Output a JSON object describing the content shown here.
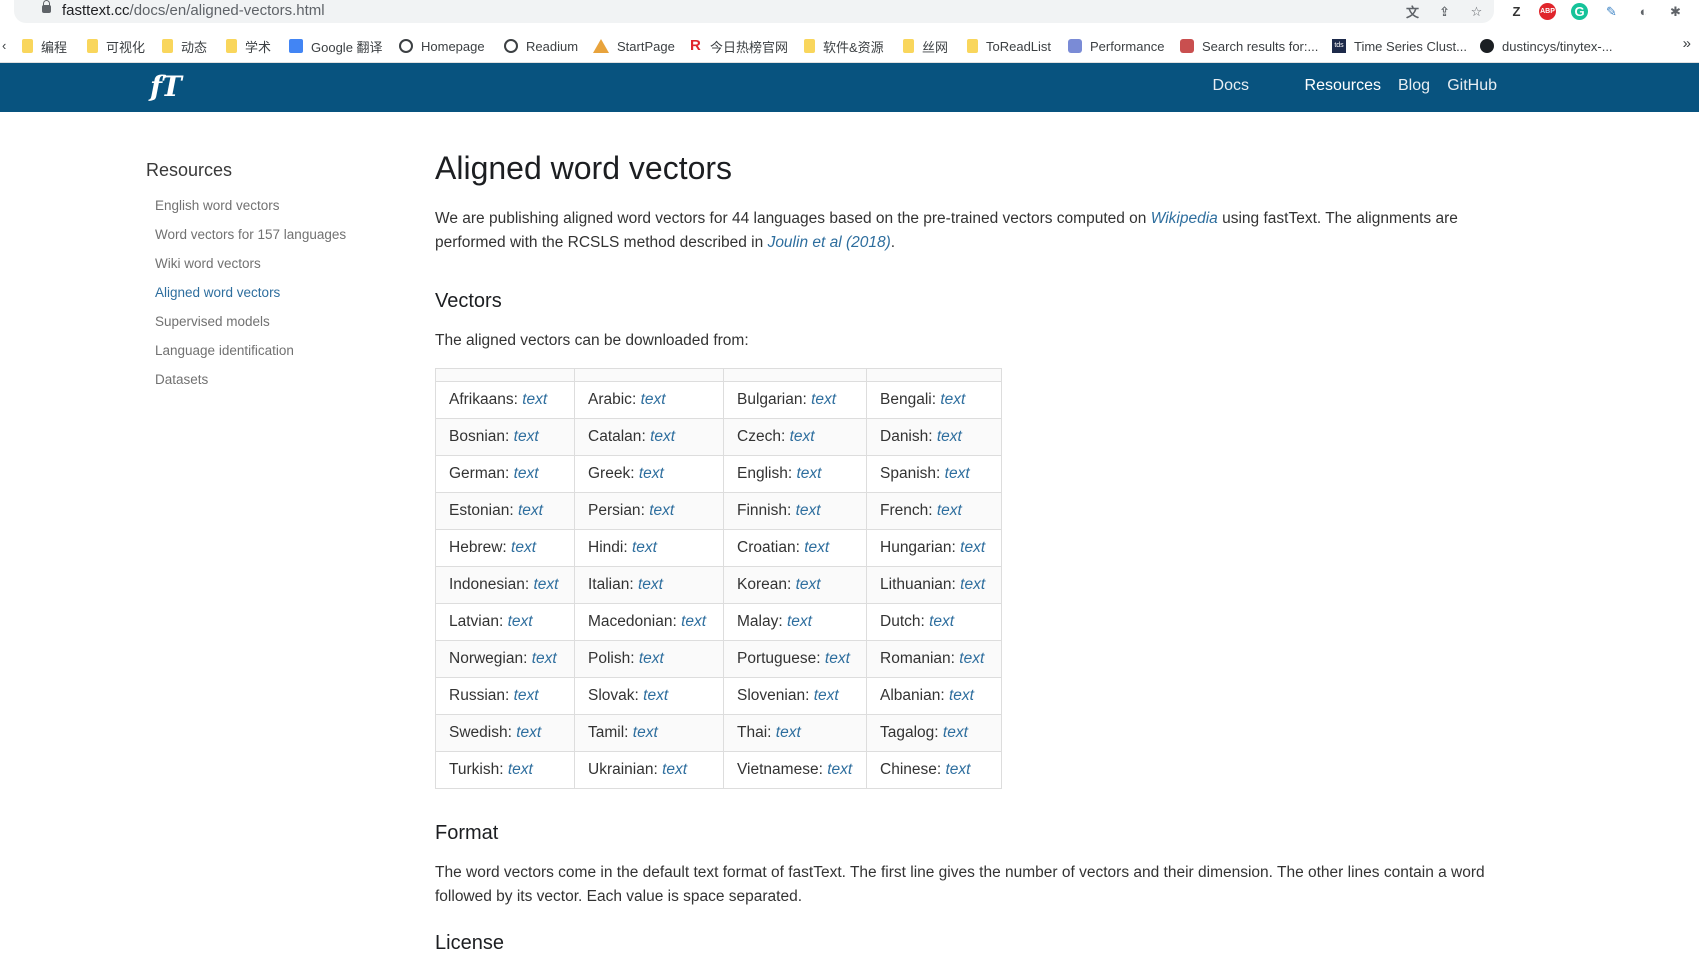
{
  "browser": {
    "url_host": "fasttext.cc",
    "url_path": "/docs/en/aligned-vectors.html"
  },
  "bookmarks": [
    {
      "label": "编程",
      "icon": "folder-icon"
    },
    {
      "label": "可视化",
      "icon": "folder-icon"
    },
    {
      "label": "动态",
      "icon": "folder-icon"
    },
    {
      "label": "学术",
      "icon": "folder-icon"
    },
    {
      "label": "Google 翻译",
      "icon": "google-translate-icon"
    },
    {
      "label": "Homepage",
      "icon": "globe-icon"
    },
    {
      "label": "Readium",
      "icon": "globe-icon"
    },
    {
      "label": "StartPage",
      "icon": "house-icon"
    },
    {
      "label": "今日热榜官网",
      "icon": "r-icon"
    },
    {
      "label": "软件&资源",
      "icon": "folder-icon"
    },
    {
      "label": "丝网",
      "icon": "folder-icon"
    },
    {
      "label": "ToReadList",
      "icon": "folder-icon"
    },
    {
      "label": "Performance",
      "icon": "performance-icon"
    },
    {
      "label": "Search results for:...",
      "icon": "search-results-icon"
    },
    {
      "label": "Time Series Clust...",
      "icon": "tds-icon"
    },
    {
      "label": "dustincys/tinytex-...",
      "icon": "github-icon"
    }
  ],
  "site": {
    "logo": "fT",
    "nav": [
      "Docs",
      "Resources",
      "Blog",
      "GitHub"
    ],
    "active_nav": "Resources"
  },
  "sidebar": {
    "title": "Resources",
    "items": [
      "English word vectors",
      "Word vectors for 157 languages",
      "Wiki word vectors",
      "Aligned word vectors",
      "Supervised models",
      "Language identification",
      "Datasets"
    ],
    "active": "Aligned word vectors"
  },
  "main": {
    "title": "Aligned word vectors",
    "intro": {
      "part1": "We are publishing aligned word vectors for 44 languages based on the pre-trained vectors computed on ",
      "link1": "Wikipedia",
      "part2": " using fastText. The alignments are performed with the RCSLS method described in ",
      "link2": "Joulin et al (2018)",
      "part3": "."
    },
    "vectors_heading": "Vectors",
    "vectors_text": "The aligned vectors can be downloaded from:",
    "link_label": "text",
    "languages": [
      [
        "Afrikaans",
        "Arabic",
        "Bulgarian",
        "Bengali"
      ],
      [
        "Bosnian",
        "Catalan",
        "Czech",
        "Danish"
      ],
      [
        "German",
        "Greek",
        "English",
        "Spanish"
      ],
      [
        "Estonian",
        "Persian",
        "Finnish",
        "French"
      ],
      [
        "Hebrew",
        "Hindi",
        "Croatian",
        "Hungarian"
      ],
      [
        "Indonesian",
        "Italian",
        "Korean",
        "Lithuanian"
      ],
      [
        "Latvian",
        "Macedonian",
        "Malay",
        "Dutch"
      ],
      [
        "Norwegian",
        "Polish",
        "Portuguese",
        "Romanian"
      ],
      [
        "Russian",
        "Slovak",
        "Slovenian",
        "Albanian"
      ],
      [
        "Swedish",
        "Tamil",
        "Thai",
        "Tagalog"
      ],
      [
        "Turkish",
        "Ukrainian",
        "Vietnamese",
        "Chinese"
      ]
    ],
    "format_heading": "Format",
    "format_text": "The word vectors come in the default text format of fastText. The first line gives the number of vectors and their dimension. The other lines contain a word followed by its vector. Each value is space separated.",
    "license_heading": "License"
  },
  "colors": {
    "nav_bg": "#08537f",
    "link": "#2e6e9e"
  }
}
